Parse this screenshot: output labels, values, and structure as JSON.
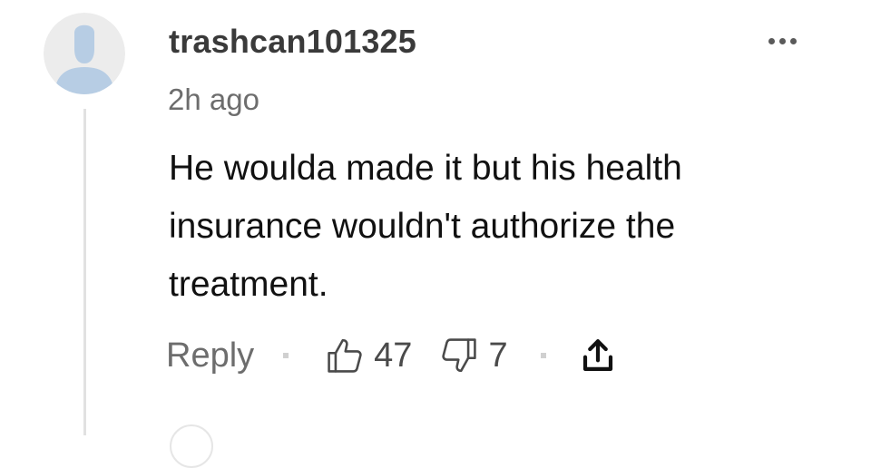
{
  "comment": {
    "username": "trashcan101325",
    "timestamp": "2h ago",
    "body": "He woulda made it but his health insurance wouldn't authorize the treatment.",
    "actions": {
      "reply_label": "Reply",
      "upvote_count": "47",
      "downvote_count": "7"
    }
  },
  "icons": {
    "avatar": "default-user-avatar",
    "more": "more-options-icon",
    "upvote": "thumbs-up-icon",
    "downvote": "thumbs-down-icon",
    "share": "share-icon"
  },
  "colors": {
    "avatar_background": "#ececec",
    "avatar_figure": "#b7cde4",
    "username": "#3a3a3a",
    "secondary_text": "#6d6d6d",
    "thread_line": "#e1e1e1"
  }
}
